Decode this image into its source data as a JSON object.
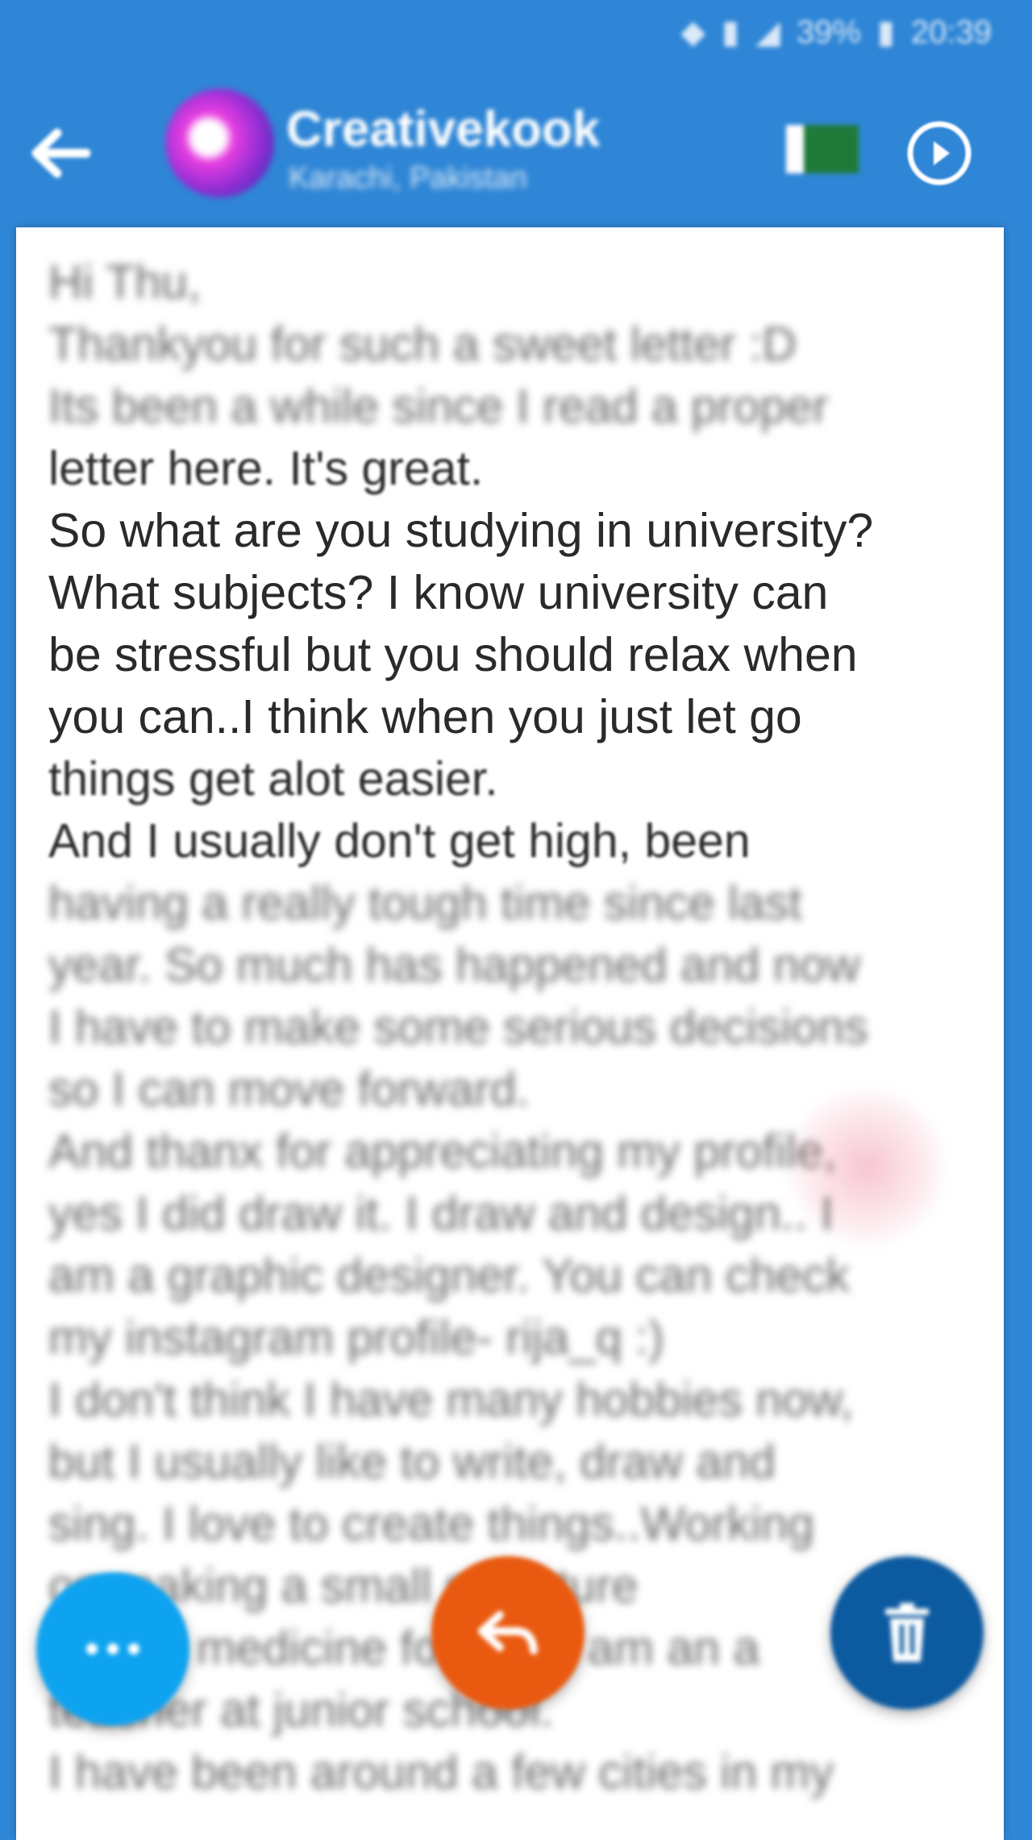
{
  "status_bar": {
    "items": [
      "◆",
      "▮",
      "◢",
      "39%",
      "▮",
      "20:39"
    ]
  },
  "header": {
    "name": "Creativekook",
    "location": "Karachi, Pakistan",
    "back_icon": "arrow-left-icon",
    "flag_icon": "pakistan-flag-icon",
    "options_icon": "circle-dot-icon",
    "bg_color": "#2f86d6"
  },
  "letter": {
    "lines": [
      "Hi Thu,",
      "Thankyou for such a sweet letter :D",
      "Its been a while since I read a proper",
      "letter here. It's great.",
      "So what are you studying in university?",
      "What subjects? I know university can",
      "be stressful but you should relax when",
      "you can..I think when you just let go",
      "things get alot easier.",
      "And I usually don't get high, been",
      "having a really tough time since last",
      "year. So much has happened and now",
      "I have to make some serious decisions",
      "so I can move forward.",
      "And thanx for appreciating my profile,",
      "yes I did draw it. I draw and design.. I",
      "am a graphic designer. You can check",
      "my instagram profile- rija_q :)",
      "I don't think I have many hobbies now,",
      "but I usually like to write, draw and",
      "sing. I love to create things..Working",
      "on making a small sculpture",
      "for the medicine for the. I am an a",
      "teacher at junior school.",
      "I have been around a few cities in my"
    ]
  },
  "fabs": {
    "more_icon": "more-horizontal-icon",
    "reply_icon": "reply-icon",
    "delete_icon": "trash-icon",
    "colors": {
      "more": "#0ea3f0",
      "reply": "#e95a10",
      "delete": "#0c5aa0"
    }
  }
}
